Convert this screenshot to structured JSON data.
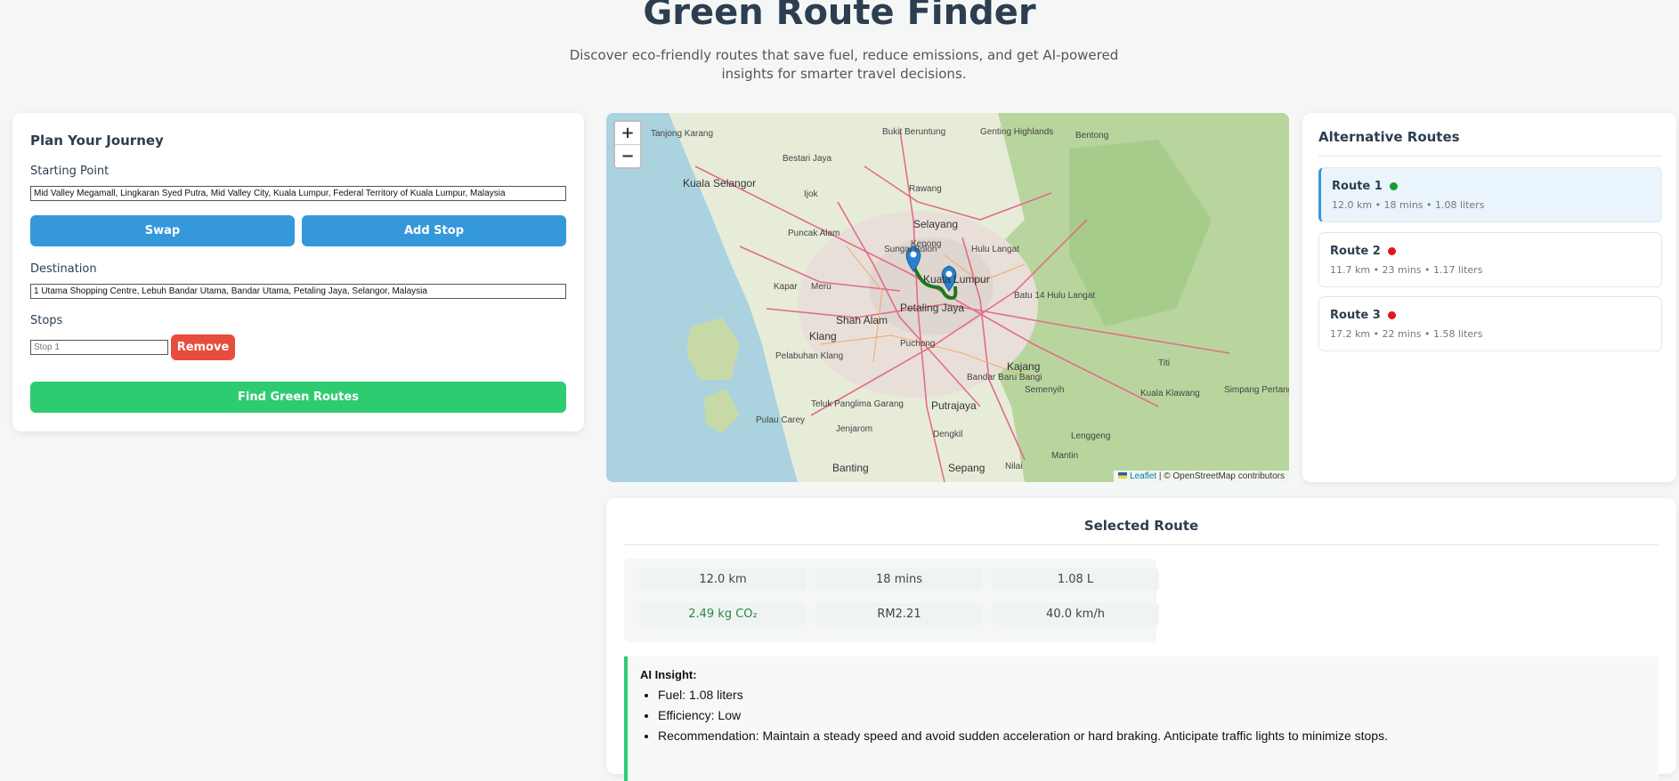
{
  "header": {
    "title": "Green Route Finder",
    "subtitle": "Discover eco-friendly routes that save fuel, reduce emissions, and get AI-powered insights for smarter travel decisions."
  },
  "plan": {
    "heading": "Plan Your Journey",
    "start_label": "Starting Point",
    "start_value": "Mid Valley Megamall, Lingkaran Syed Putra, Mid Valley City, Kuala Lumpur, Federal Territory of Kuala Lumpur, Malaysia",
    "swap_label": "Swap",
    "add_stop_label": "Add Stop",
    "destination_label": "Destination",
    "destination_value": "1 Utama Shopping Centre, Lebuh Bandar Utama, Bandar Utama, Petaling Jaya, Selangor, Malaysia",
    "stops_label": "Stops",
    "stop_placeholder": "Stop 1",
    "remove_label": "Remove",
    "find_label": "Find Green Routes"
  },
  "map": {
    "zoom_in": "+",
    "zoom_out": "−",
    "attribution_leaflet": "Leaflet",
    "attribution_rest": " | © OpenStreetMap contributors",
    "labels": [
      "Tanjong Karang",
      "Kuala Selangor",
      "Bestari Jaya",
      "Bukit Beruntung",
      "Genting Highlands",
      "Bentong",
      "Rawang",
      "Selayang",
      "Puncak Alam",
      "Sungai Buloh",
      "Kepong",
      "Hulu Langat",
      "Kuala Lumpur",
      "Petaling Jaya",
      "Shah Alam",
      "Klang",
      "Kapar",
      "Meru",
      "Puchong",
      "Kajang",
      "Bandar Baru Bangi",
      "Putrajaya",
      "Semenyih",
      "Teluk Panglima Garang",
      "Jenjarom",
      "Pulau Carey",
      "Banting",
      "Sepang",
      "Dengkil",
      "Nilai",
      "Mantin",
      "Lenggeng",
      "Kuala Klawang",
      "Simpang Pertang",
      "Titi",
      "Pelabuhan Klang",
      "Ijok",
      "Batu 14 Hulu Langat"
    ]
  },
  "alternatives": {
    "heading": "Alternative Routes",
    "routes": [
      {
        "name": "Route 1",
        "meta": "12.0 km • 18 mins • 1.08 liters",
        "color": "#1a9a2a"
      },
      {
        "name": "Route 2",
        "meta": "11.7 km • 23 mins • 1.17 liters",
        "color": "#e8111a"
      },
      {
        "name": "Route 3",
        "meta": "17.2 km • 22 mins • 1.58 liters",
        "color": "#e8111a"
      }
    ]
  },
  "selected": {
    "heading": "Selected Route",
    "distance": "12.0 km",
    "duration": "18 mins",
    "fuel": "1.08 L",
    "co2": "2.49 kg CO₂",
    "cost": "RM2.21",
    "speed": "40.0 km/h",
    "insight_title": "AI Insight:",
    "insights": [
      "Fuel: 1.08 liters",
      "Efficiency: Low",
      "Recommendation: Maintain a steady speed and avoid sudden acceleration or hard braking. Anticipate traffic lights to minimize stops."
    ]
  },
  "colors": {
    "accent_blue": "#3498db",
    "accent_green": "#2ecc71",
    "accent_red": "#e74c3c",
    "route_line": "#1c7a1c"
  }
}
